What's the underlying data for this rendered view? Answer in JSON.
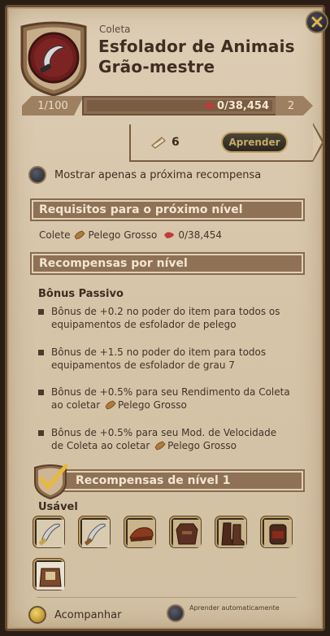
{
  "header": {
    "category": "Coleta",
    "title_line1": "Esfolador de Animais",
    "title_line2": "Grão-mestre"
  },
  "level": {
    "current": "1/100",
    "progress_text": "0/38,454",
    "next": "2",
    "progress_fraction": 0
  },
  "learn": {
    "cost": "6",
    "button_label": "Aprender"
  },
  "toggles": {
    "show_next_only": "Mostrar apenas a próxima recompensa",
    "track": "Acompanhar",
    "auto_learn": "Aprender automaticamente"
  },
  "requirements": {
    "header": "Requisitos para o próximo nível",
    "prefix": "Colete",
    "item": "Pelego Grosso",
    "amount": "0/38,454"
  },
  "rewards": {
    "header": "Recompensas por nível",
    "passive_title": "Bônus Passivo",
    "bonuses": [
      {
        "text": "Bônus de +0.2 no poder do item para todos os equipamentos de esfolador de pelego"
      },
      {
        "text": "Bônus de +1.5 no poder do item para todos equipamentos de esfolador de grau 7"
      },
      {
        "text_a": "Bônus de +0.5% para seu Rendimento da Coleta ao coletar",
        "item": "Pelego Grosso"
      },
      {
        "text_a": "Bônus de +0.5% para seu Mod. de Velocidade de Coleta ao coletar",
        "item": "Pelego Grosso"
      }
    ],
    "level_header": "Recompensas de nível 1",
    "usable_title": "Usável",
    "items": [
      "skinning-knife-icon",
      "skinning-knife-icon",
      "skinning-cap-icon",
      "skinning-garb-icon",
      "skinning-boots-icon",
      "skinning-backpack-icon",
      "skinning-backpack-open-icon"
    ]
  },
  "colors": {
    "accent_gold": "#c4a064",
    "panel_bg": "#d8c7ab",
    "bar_brown": "#8f7155"
  }
}
